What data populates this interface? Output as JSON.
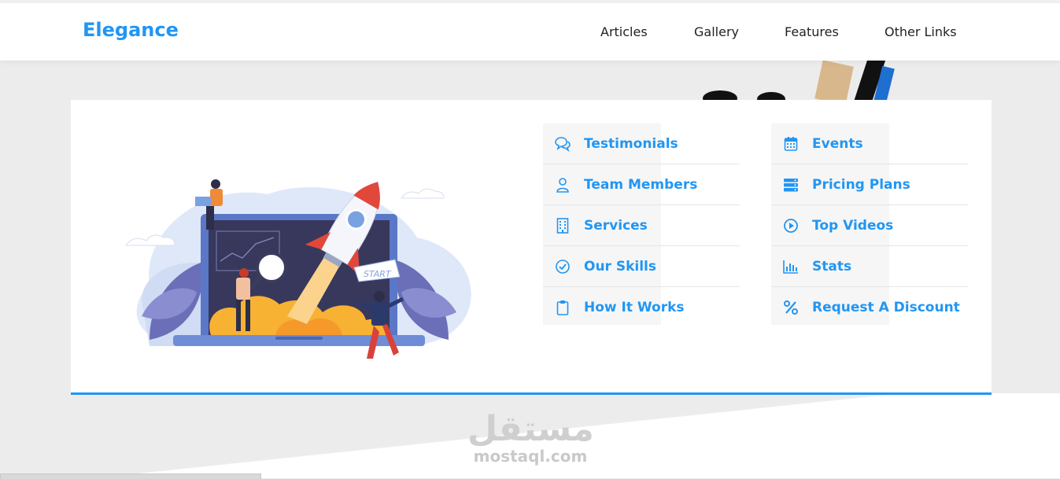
{
  "header": {
    "logo": "Elegance",
    "nav": [
      {
        "label": "Articles"
      },
      {
        "label": "Gallery"
      },
      {
        "label": "Features"
      },
      {
        "label": "Other Links"
      }
    ]
  },
  "menu": {
    "left": [
      {
        "label": "Testimonials",
        "icon": "comments-icon"
      },
      {
        "label": "Team Members",
        "icon": "user-icon"
      },
      {
        "label": "Services",
        "icon": "building-icon"
      },
      {
        "label": "Our Skills",
        "icon": "check-circle-icon"
      },
      {
        "label": "How It Works",
        "icon": "clipboard-icon"
      }
    ],
    "right": [
      {
        "label": "Events",
        "icon": "calendar-icon"
      },
      {
        "label": "Pricing Plans",
        "icon": "server-icon"
      },
      {
        "label": "Top Videos",
        "icon": "play-circle-icon"
      },
      {
        "label": "Stats",
        "icon": "bar-chart-icon"
      },
      {
        "label": "Request A Discount",
        "icon": "percent-icon"
      }
    ]
  },
  "illustration": {
    "start_label": "START"
  },
  "watermark": {
    "arabic": "مستقل",
    "latin": "mostaql.com"
  },
  "colors": {
    "accent": "#2196f3",
    "text": "#222222"
  }
}
